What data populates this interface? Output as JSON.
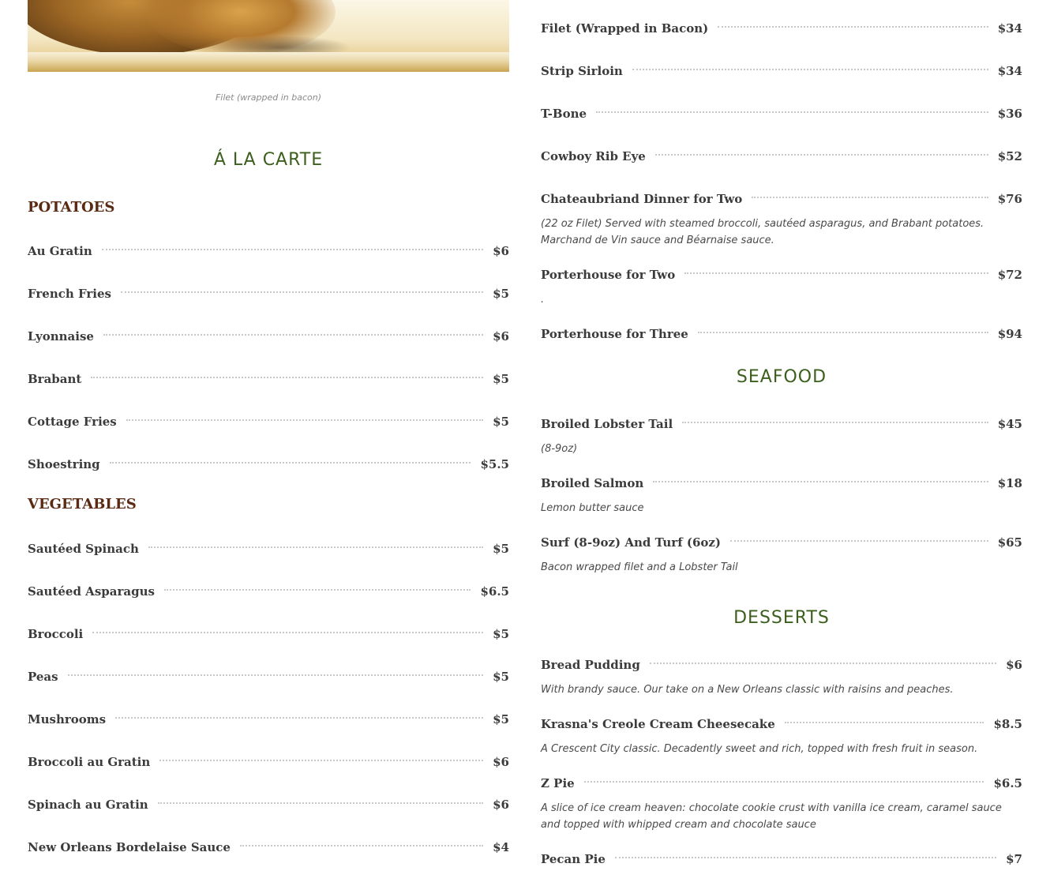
{
  "photo_caption": "Filet (wrapped in bacon)",
  "a_la_carte": {
    "title": "Á LA CARTE",
    "potatoes": {
      "title": "POTATOES",
      "items": [
        {
          "name": "Au Gratin",
          "price": "$6"
        },
        {
          "name": "French Fries",
          "price": "$5"
        },
        {
          "name": "Lyonnaise",
          "price": "$6"
        },
        {
          "name": "Brabant",
          "price": "$5"
        },
        {
          "name": "Cottage Fries",
          "price": "$5"
        },
        {
          "name": "Shoestring",
          "price": "$5.5"
        }
      ]
    },
    "vegetables": {
      "title": "VEGETABLES",
      "items": [
        {
          "name": "Sautéed Spinach",
          "price": "$5"
        },
        {
          "name": "Sautéed Asparagus",
          "price": "$6.5"
        },
        {
          "name": "Broccoli",
          "price": "$5"
        },
        {
          "name": "Peas",
          "price": "$5"
        },
        {
          "name": "Mushrooms",
          "price": "$5"
        },
        {
          "name": "Broccoli au Gratin",
          "price": "$6"
        },
        {
          "name": "Spinach au Gratin",
          "price": "$6"
        },
        {
          "name": "New Orleans Bordelaise Sauce",
          "price": "$4"
        }
      ]
    }
  },
  "steaks": {
    "items": [
      {
        "name": "Filet (Wrapped in Bacon)",
        "price": "$34"
      },
      {
        "name": "Strip Sirloin",
        "price": "$34"
      },
      {
        "name": "T-Bone",
        "price": "$36"
      },
      {
        "name": "Cowboy Rib Eye",
        "price": "$52"
      },
      {
        "name": "Chateaubriand Dinner for Two",
        "price": "$76",
        "desc": "(22 oz Filet) Served with steamed broccoli, sautéed asparagus, and Brabant potatoes. Marchand de Vin sauce and Béarnaise sauce."
      },
      {
        "name": "Porterhouse for Two",
        "price": "$72",
        "desc": "."
      },
      {
        "name": "Porterhouse for Three",
        "price": "$94"
      }
    ]
  },
  "seafood": {
    "title": "SEAFOOD",
    "items": [
      {
        "name": "Broiled Lobster Tail",
        "price": "$45",
        "desc": "(8-9oz)"
      },
      {
        "name": "Broiled Salmon",
        "price": "$18",
        "desc": "Lemon butter sauce"
      },
      {
        "name": "Surf (8-9oz) And Turf (6oz)",
        "price": "$65",
        "desc": "Bacon wrapped filet and a Lobster Tail"
      }
    ]
  },
  "desserts": {
    "title": "DESSERTS",
    "items": [
      {
        "name": "Bread Pudding",
        "price": "$6",
        "desc": "With brandy sauce. Our take on a New Orleans classic with raisins and peaches."
      },
      {
        "name": "Krasna's Creole Cream Cheesecake",
        "price": "$8.5",
        "desc": "A Crescent City classic. Decadently sweet and rich, topped with fresh fruit in season."
      },
      {
        "name": "Z Pie",
        "price": "$6.5",
        "desc": "A slice of ice cream heaven: chocolate cookie crust with vanilla ice cream, caramel sauce and topped with whipped cream and chocolate sauce"
      },
      {
        "name": "Pecan Pie",
        "price": "$7"
      }
    ]
  }
}
